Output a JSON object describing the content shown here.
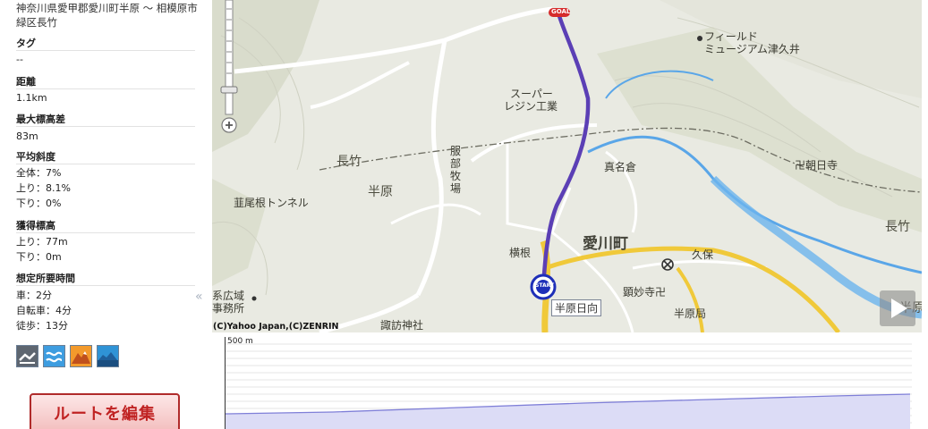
{
  "route": {
    "title": "神奈川県愛甲郡愛川町半原 〜 相模原市緑区長竹"
  },
  "sections": {
    "tag": {
      "head": "タグ",
      "value": "--"
    },
    "distance": {
      "head": "距離",
      "value": "1.1km"
    },
    "max_elev_diff": {
      "head": "最大標高差",
      "value": "83m"
    },
    "avg_grade": {
      "head": "平均斜度",
      "total": "全体：7%",
      "up": "上り：8.1%",
      "down": "下り：0%"
    },
    "gain": {
      "head": "獲得標高",
      "up": "上り：77m",
      "down": "下り：0m"
    },
    "time": {
      "head": "想定所要時間",
      "car": "車：2分",
      "bike": "自転車：4分",
      "walk": "徒歩：13分"
    }
  },
  "buttons": {
    "edit_route": "ルートを編集",
    "collapse": "«"
  },
  "icons": [
    "walk-mode-icon",
    "bike-mode-icon",
    "mountain-mode-icon",
    "sea-mode-icon"
  ],
  "map": {
    "labels": {
      "field_museum_1": "フィールド",
      "field_museum_2": "ミュージアム津久井",
      "super_1": "スーパー",
      "super_2": "レジン工業",
      "nagatake": "長竹",
      "nagatake_2": "長竹",
      "hanbara": "半原",
      "hanbara_2": "半原",
      "hattori": "服部牧場",
      "tunnel": "韮尾根トンネル",
      "manakura": "真名倉",
      "choujitsuji": "卍朝日寺",
      "aikawa": "愛川町",
      "yokone": "横根",
      "kubo": "久保",
      "keimyoji": "顕妙寺卍",
      "hanbara_hinata": "半原日向",
      "hanbara_post": "半原局",
      "suwa": "諏訪神社",
      "office_1": "系広域",
      "office_2": "事務所",
      "goal": "GOAL",
      "start": "START"
    },
    "copyright": "(C)Yahoo Japan,(C)ZENRIN",
    "colors": {
      "route": "#5b3fb5",
      "road_main": "#f0c93a",
      "river": "#5aa6e8"
    }
  },
  "elevation": {
    "scale_label": "500 m",
    "colors": {
      "fill": "#dcdcf6",
      "line": "#7f7fd8"
    }
  }
}
